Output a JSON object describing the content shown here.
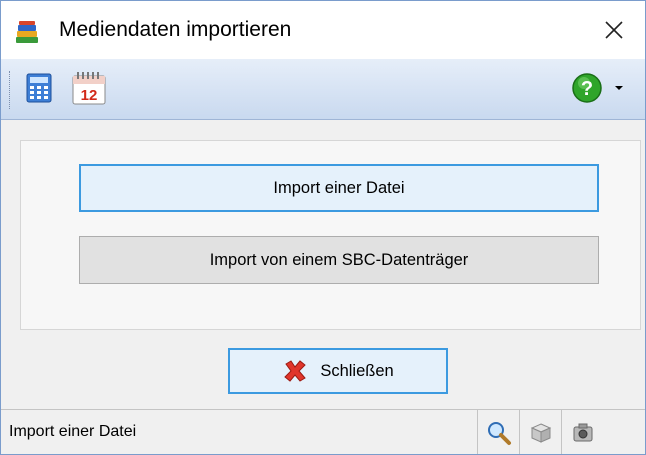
{
  "window": {
    "title": "Mediendaten importieren"
  },
  "toolbar": {
    "calendar_day": "12"
  },
  "main": {
    "import_file_label": "Import einer Datei",
    "import_sbc_label": "Import von einem SBC-Datenträger"
  },
  "footer": {
    "close_label": "Schließen"
  },
  "statusbar": {
    "text": "Import einer Datei"
  },
  "icons": {
    "app": "books-icon",
    "close": "close-icon",
    "calculator": "calculator-icon",
    "calendar": "calendar-icon",
    "help": "help-icon",
    "dropdown": "chevron-down-icon",
    "close_button": "red-x-icon",
    "zoom": "magnifier-icon",
    "cube": "cube-icon",
    "camera": "camera-icon"
  },
  "colors": {
    "accent_border": "#3c9ae0",
    "primary_button_bg": "#e5f1fb",
    "toolbar_top": "#e6eef9",
    "toolbar_bottom": "#c9d9ef",
    "help_green": "#2fa52a",
    "close_red": "#e0352b"
  }
}
